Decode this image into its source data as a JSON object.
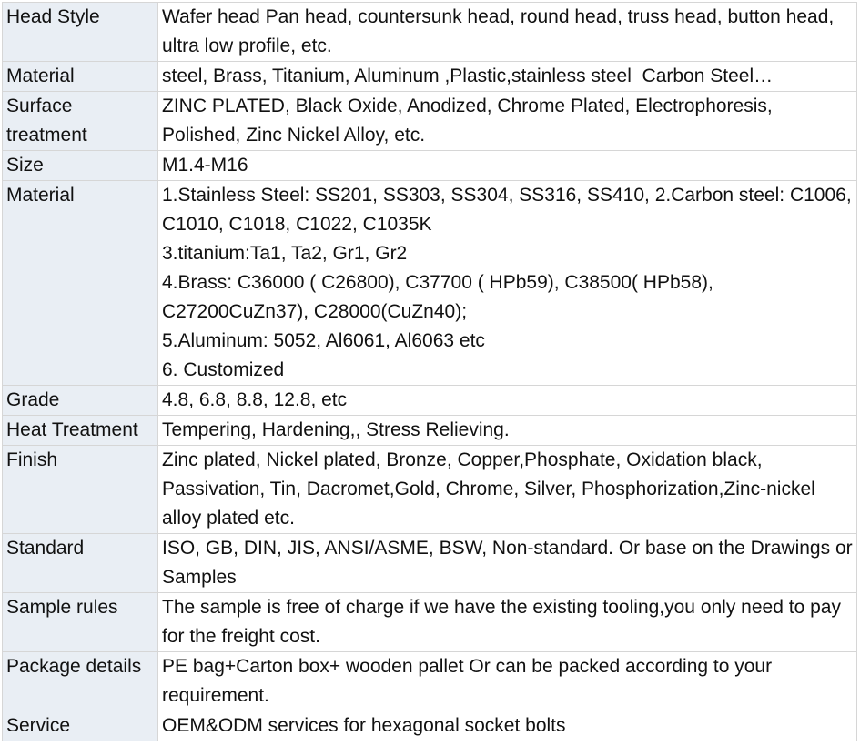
{
  "rows": [
    {
      "label": "Head Style",
      "lines": [
        "Wafer head Pan head, countersunk head, round head, truss head, button head, ultra low profile, etc."
      ]
    },
    {
      "label": "Material",
      "lines": [
        "steel, Brass, Titanium, Aluminum ,Plastic,stainless steel  Carbon Steel…"
      ]
    },
    {
      "label": "Surface treatment",
      "lines": [
        "ZINC PLATED, Black Oxide, Anodized, Chrome Plated, Electrophoresis, Polished, Zinc Nickel Alloy, etc."
      ]
    },
    {
      "label": "Size",
      "lines": [
        "M1.4-M16"
      ]
    },
    {
      "label": "Material",
      "lines": [
        "1.Stainless Steel: SS201, SS303, SS304, SS316, SS410, 2.Carbon steel: C1006, C1010, C1018, C1022, C1035K",
        "3.titanium:Ta1, Ta2, Gr1, Gr2",
        "4.Brass: C36000 ( C26800), C37700 ( HPb59), C38500( HPb58), C27200CuZn37), C28000(CuZn40);",
        "5.Aluminum: 5052, Al6061, Al6063 etc",
        "6. Customized"
      ]
    },
    {
      "label": "Grade",
      "lines": [
        "4.8, 6.8, 8.8, 12.8, etc"
      ]
    },
    {
      "label": "Heat Treatment",
      "lines": [
        "Tempering, Hardening,, Stress Relieving."
      ]
    },
    {
      "label": "Finish",
      "lines": [
        "Zinc plated, Nickel plated, Bronze, Copper,Phosphate, Oxidation black, Passivation, Tin, Dacromet,Gold, Chrome, Silver, Phosphorization,Zinc-nickel alloy plated etc."
      ]
    },
    {
      "label": "Standard",
      "lines": [
        "ISO, GB, DIN, JIS, ANSI/ASME, BSW, Non-standard. Or base on the Drawings or Samples"
      ]
    },
    {
      "label": "Sample rules",
      "lines": [
        "The sample is free of charge if we have the existing tooling,you only need to pay for the freight cost."
      ]
    },
    {
      "label": "Package details",
      "lines": [
        "PE bag+Carton box+ wooden pallet Or can be packed according to your requirement."
      ]
    },
    {
      "label": "Service",
      "lines": [
        "OEM&ODM services for hexagonal socket bolts"
      ]
    }
  ]
}
